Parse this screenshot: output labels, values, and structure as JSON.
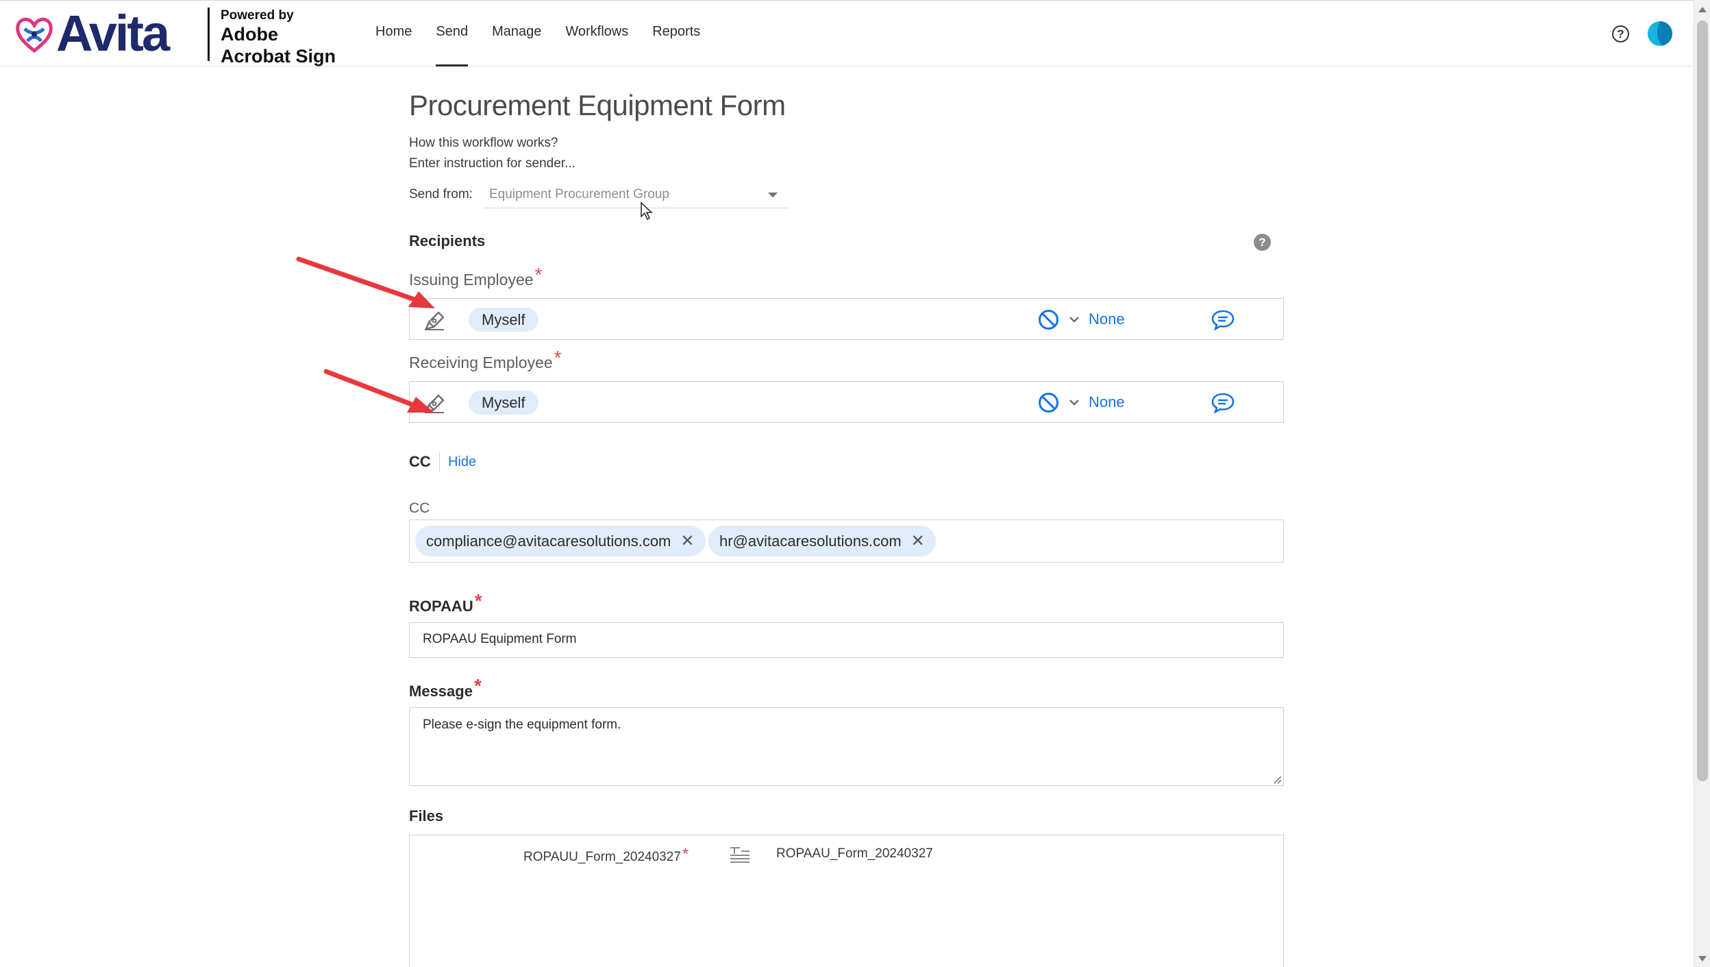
{
  "header": {
    "logo_text": "Avita",
    "powered_line1": "Powered by",
    "powered_line2": "Adobe",
    "powered_line3": "Acrobat Sign",
    "nav": [
      {
        "label": "Home",
        "active": false
      },
      {
        "label": "Send",
        "active": true
      },
      {
        "label": "Manage",
        "active": false
      },
      {
        "label": "Workflows",
        "active": false
      },
      {
        "label": "Reports",
        "active": false
      }
    ],
    "help_icon": "question-circle-icon",
    "avatar_icon": "user-avatar"
  },
  "form": {
    "title": "Procurement Equipment Form",
    "how_it_works": "How this workflow works?",
    "instruction": "Enter instruction for sender...",
    "send_from": {
      "label": "Send from:",
      "value": "Equipment Procurement Group"
    }
  },
  "recipients": {
    "heading": "Recipients",
    "rows": [
      {
        "label": "Issuing Employee",
        "required_mark": "*",
        "recipient": "Myself",
        "auth": "None",
        "role_icon": "pen-sign-icon"
      },
      {
        "label": "Receiving Employee",
        "required_mark": "*",
        "recipient": "Myself",
        "auth": "None",
        "role_icon": "pen-sign-icon"
      }
    ]
  },
  "cc": {
    "heading": "CC",
    "toggle": "Hide",
    "label": "CC",
    "emails": [
      "compliance@avitacaresolutions.com",
      "hr@avitacaresolutions.com"
    ],
    "remove_glyph": "✕"
  },
  "ropaau": {
    "label": "ROPAAU",
    "required_mark": "*",
    "value": "ROPAAU Equipment Form"
  },
  "message": {
    "label": "Message",
    "required_mark": "*",
    "value": "Please e-sign the equipment form."
  },
  "files": {
    "label": "Files",
    "required_name": "ROPAUU_Form_20240327",
    "required_mark": "*",
    "attached_name": "ROPAAU_Form_20240327"
  },
  "colors": {
    "accent": "#1473e6",
    "required": "#e34850",
    "chip_bg": "#e0ecfa",
    "annotation_arrow": "#e8383d",
    "logo_navy": "#1f2a6b",
    "logo_pink": "#e0357f"
  }
}
